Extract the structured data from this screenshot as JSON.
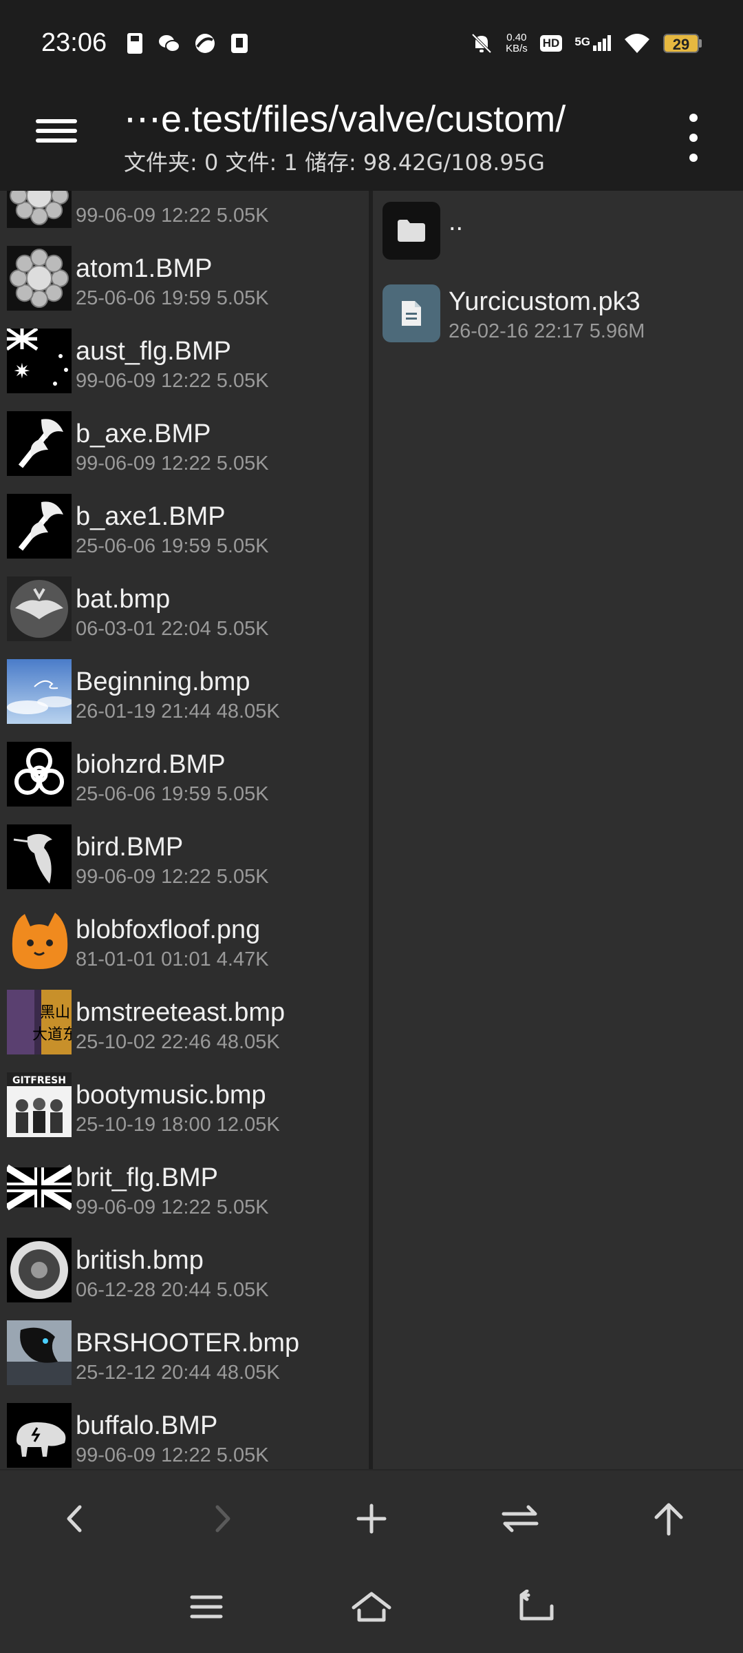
{
  "status_bar": {
    "time": "23:06",
    "net_speed_value": "0.40",
    "net_speed_unit": "KB/s",
    "hd_label": "HD",
    "network_label": "5G",
    "battery_level": "29",
    "icons": [
      "sim-icon",
      "wechat-icon",
      "app-icon",
      "notification-icon",
      "mute-bell-icon",
      "signal-icon",
      "wifi-icon",
      "battery-icon"
    ]
  },
  "toolbar": {
    "path": "⋯e.test/files/valve/custom/",
    "info": "文件夹: 0  文件: 1  储存: 98.42G/108.95G"
  },
  "left_files": [
    {
      "name": "",
      "meta": "99-06-09 12:22  5.05K",
      "thumb": "atom"
    },
    {
      "name": "atom1.BMP",
      "meta": "25-06-06 19:59  5.05K",
      "thumb": "atom"
    },
    {
      "name": "aust_flg.BMP",
      "meta": "99-06-09 12:22  5.05K",
      "thumb": "aust"
    },
    {
      "name": "b_axe.BMP",
      "meta": "99-06-09 12:22  5.05K",
      "thumb": "axe"
    },
    {
      "name": "b_axe1.BMP",
      "meta": "25-06-06 19:59  5.05K",
      "thumb": "axe"
    },
    {
      "name": "bat.bmp",
      "meta": "06-03-01 22:04  5.05K",
      "thumb": "bat"
    },
    {
      "name": "Beginning.bmp",
      "meta": "26-01-19 21:44  48.05K",
      "thumb": "sky"
    },
    {
      "name": "biohzrd.BMP",
      "meta": "25-06-06 19:59  5.05K",
      "thumb": "bio"
    },
    {
      "name": "bird.BMP",
      "meta": "99-06-09 12:22  5.05K",
      "thumb": "bird"
    },
    {
      "name": "blobfoxfloof.png",
      "meta": "81-01-01 01:01  4.47K",
      "thumb": "fox"
    },
    {
      "name": "bmstreeteast.bmp",
      "meta": "25-10-02 22:46  48.05K",
      "thumb": "street"
    },
    {
      "name": "bootymusic.bmp",
      "meta": "25-10-19 18:00  12.05K",
      "thumb": "booty"
    },
    {
      "name": "brit_flg.BMP",
      "meta": "99-06-09 12:22  5.05K",
      "thumb": "brit"
    },
    {
      "name": "british.bmp",
      "meta": "06-12-28 20:44  5.05K",
      "thumb": "british"
    },
    {
      "name": "BRSHOOTER.bmp",
      "meta": "25-12-12 20:44  48.05K",
      "thumb": "brs"
    },
    {
      "name": "buffalo.BMP",
      "meta": "99-06-09 12:22  5.05K",
      "thumb": "buffalo"
    }
  ],
  "right_pane": {
    "parent_label": "..",
    "file_name": "Yurcicustom.pk3",
    "file_meta": "26-02-16 22:17  5.96M"
  },
  "bottom_bar": [
    "back-icon",
    "forward-icon",
    "add-icon",
    "swap-icon",
    "up-icon"
  ],
  "nav_bar": [
    "menu-icon",
    "home-icon",
    "return-icon"
  ]
}
